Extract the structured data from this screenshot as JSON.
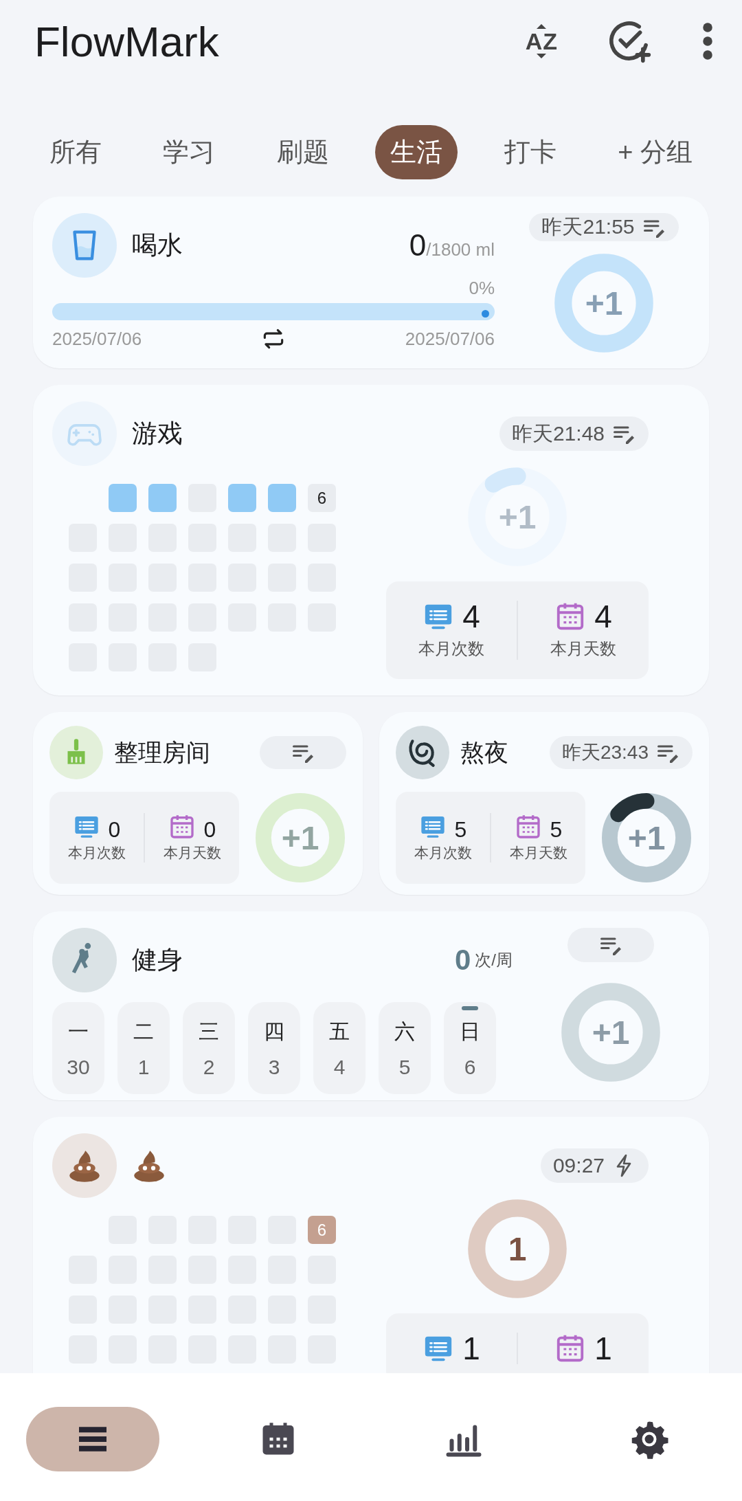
{
  "app_bar": {
    "title": "FlowMark",
    "sort_label": "AZ"
  },
  "tabs": [
    {
      "label": "所有",
      "selected": false
    },
    {
      "label": "学习",
      "selected": false
    },
    {
      "label": "刷题",
      "selected": false
    },
    {
      "label": "生活",
      "selected": true
    },
    {
      "label": "打卡",
      "selected": false
    },
    {
      "label": "+ 分组",
      "selected": false
    }
  ],
  "cards": [
    {
      "kind": "goal",
      "title": "喝水",
      "value": "0",
      "unit": "/1800 ml",
      "percent": "0%",
      "level": 0,
      "start_date": "2025/07/06",
      "end_date": "2025/07/06",
      "pill": {
        "kind": "edit",
        "time": "昨天21:55"
      },
      "ring": {
        "kind": "add",
        "label": "+1",
        "color": "#c4e3fa"
      }
    },
    {
      "kind": "heatmap",
      "title": "游戏",
      "pill": {
        "kind": "edit",
        "time": "昨天21:48"
      },
      "ring": {
        "kind": "add",
        "label": "+1",
        "color": "#eef6fe",
        "arc": {
          "level": 0.1,
          "color": "#c8e4fa"
        }
      },
      "dimmed": true,
      "heatmap": {
        "color": "#90caf5",
        "cells": [
          {
            "kind": "blank"
          },
          {
            "kind": "day",
            "filled": true
          },
          {
            "kind": "day",
            "filled": true
          },
          {
            "kind": "day",
            "filled": false
          },
          {
            "kind": "day",
            "filled": true
          },
          {
            "kind": "day",
            "filled": true
          },
          {
            "kind": "day",
            "filled": false,
            "label": "6"
          },
          {
            "kind": "day",
            "filled": false
          },
          {
            "kind": "day",
            "filled": false
          },
          {
            "kind": "day",
            "filled": false
          },
          {
            "kind": "day",
            "filled": false
          },
          {
            "kind": "day",
            "filled": false
          },
          {
            "kind": "day",
            "filled": false
          },
          {
            "kind": "day",
            "filled": false
          },
          {
            "kind": "day",
            "filled": false
          },
          {
            "kind": "day",
            "filled": false
          },
          {
            "kind": "day",
            "filled": false
          },
          {
            "kind": "day",
            "filled": false
          },
          {
            "kind": "day",
            "filled": false
          },
          {
            "kind": "day",
            "filled": false
          },
          {
            "kind": "day",
            "filled": false
          },
          {
            "kind": "day",
            "filled": false
          },
          {
            "kind": "day",
            "filled": false
          },
          {
            "kind": "day",
            "filled": false
          },
          {
            "kind": "day",
            "filled": false
          },
          {
            "kind": "day",
            "filled": false
          },
          {
            "kind": "day",
            "filled": false
          },
          {
            "kind": "day",
            "filled": false
          },
          {
            "kind": "day",
            "filled": false
          },
          {
            "kind": "day",
            "filled": false
          },
          {
            "kind": "day",
            "filled": false
          },
          {
            "kind": "day",
            "filled": false
          }
        ]
      },
      "stats": [
        {
          "kind": "count",
          "value": "4",
          "label": "本月次数"
        },
        {
          "kind": "days",
          "value": "4",
          "label": "本月天数"
        }
      ]
    },
    {
      "kind": "pair",
      "items": [
        {
          "kind": "compact",
          "title": "整理房间",
          "pill": {
            "kind": "edit"
          },
          "ring": {
            "kind": "add",
            "label": "+1",
            "color": "#dcefd0"
          },
          "stats": [
            {
              "kind": "count",
              "value": "0",
              "label": "本月次数"
            },
            {
              "kind": "days",
              "value": "0",
              "label": "本月天数"
            }
          ]
        },
        {
          "kind": "compact",
          "title": "熬夜",
          "pill": {
            "kind": "edit",
            "time": "昨天23:43"
          },
          "ring": {
            "kind": "add",
            "label": "+1",
            "color": "#b8c8d0",
            "arc": {
              "level": 0.14,
              "color": "#263238"
            }
          },
          "stats": [
            {
              "kind": "count",
              "value": "5",
              "label": "本月次数"
            },
            {
              "kind": "days",
              "value": "5",
              "label": "本月天数"
            }
          ]
        }
      ]
    },
    {
      "kind": "weekly",
      "title": "健身",
      "value": "0",
      "unit": "次/周",
      "pill": {
        "kind": "edit"
      },
      "ring": {
        "kind": "add",
        "label": "+1",
        "color": "#d0dbdf"
      },
      "days": [
        {
          "day": "一",
          "date": "30",
          "selected": false
        },
        {
          "day": "二",
          "date": "1",
          "selected": false
        },
        {
          "day": "三",
          "date": "2",
          "selected": false
        },
        {
          "day": "四",
          "date": "3",
          "selected": false
        },
        {
          "day": "五",
          "date": "4",
          "selected": false
        },
        {
          "day": "六",
          "date": "5",
          "selected": false
        },
        {
          "day": "日",
          "date": "6",
          "selected": true
        }
      ]
    },
    {
      "kind": "heatmap",
      "pill": {
        "kind": "bolt",
        "time": "09:27"
      },
      "ring": {
        "kind": "count",
        "label": "1",
        "color": "#dfcbc2"
      },
      "dimmed": false,
      "heatmap": {
        "color": "#c4a090",
        "cells": [
          {
            "kind": "blank"
          },
          {
            "kind": "day",
            "filled": false
          },
          {
            "kind": "day",
            "filled": false
          },
          {
            "kind": "day",
            "filled": false
          },
          {
            "kind": "day",
            "filled": false
          },
          {
            "kind": "day",
            "filled": false
          },
          {
            "kind": "day",
            "filled": true,
            "label": "6"
          },
          {
            "kind": "day",
            "filled": false
          },
          {
            "kind": "day",
            "filled": false
          },
          {
            "kind": "day",
            "filled": false
          },
          {
            "kind": "day",
            "filled": false
          },
          {
            "kind": "day",
            "filled": false
          },
          {
            "kind": "day",
            "filled": false
          },
          {
            "kind": "day",
            "filled": false
          },
          {
            "kind": "day",
            "filled": false
          },
          {
            "kind": "day",
            "filled": false
          },
          {
            "kind": "day",
            "filled": false
          },
          {
            "kind": "day",
            "filled": false
          },
          {
            "kind": "day",
            "filled": false
          },
          {
            "kind": "day",
            "filled": false
          },
          {
            "kind": "day",
            "filled": false
          },
          {
            "kind": "day",
            "filled": false
          },
          {
            "kind": "day",
            "filled": false
          },
          {
            "kind": "day",
            "filled": false
          },
          {
            "kind": "day",
            "filled": false
          },
          {
            "kind": "day",
            "filled": false
          },
          {
            "kind": "day",
            "filled": false
          },
          {
            "kind": "day",
            "filled": false
          }
        ]
      },
      "stats": [
        {
          "kind": "count",
          "value": "1"
        },
        {
          "kind": "days",
          "value": "1"
        }
      ]
    }
  ],
  "nav": [
    {
      "selected": true
    },
    {
      "selected": false
    },
    {
      "selected": false
    },
    {
      "selected": false
    }
  ]
}
